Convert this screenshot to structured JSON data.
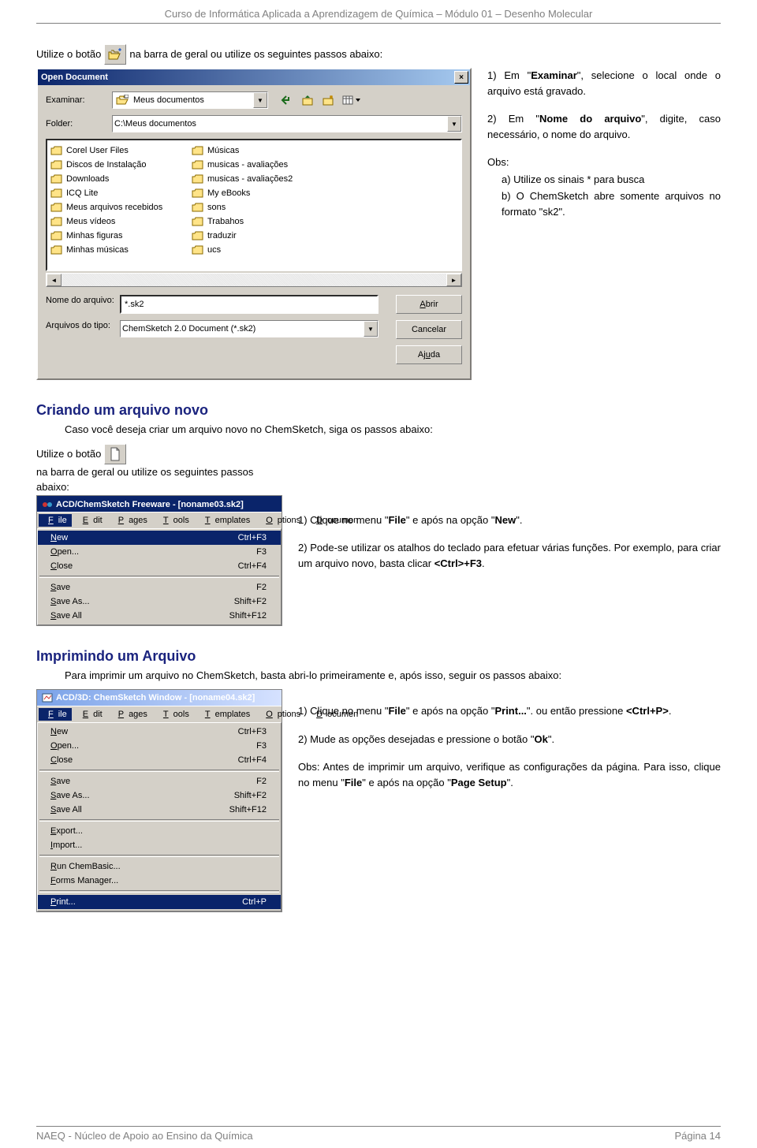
{
  "header": "Curso de Informática Aplicada a Aprendizagem de Química – Módulo 01 – Desenho Molecular",
  "intro_before": "Utilize o botão ",
  "intro_after": " na barra de geral  ou utilize os seguintes passos abaixo:",
  "dlg": {
    "title": "Open Document",
    "lbl_examinar": "Examinar:",
    "combo_examinar": "Meus documentos",
    "lbl_folder": "Folder:",
    "combo_folder": "C:\\Meus documentos",
    "files": [
      "Corel User Files",
      "Discos de Instalação",
      "Downloads",
      "ICQ Lite",
      "Meus arquivos recebidos",
      "Meus vídeos",
      "Minhas figuras",
      "Minhas músicas",
      "Músicas",
      "musicas - avaliações",
      "musicas - avaliações2",
      "My eBooks",
      "sons",
      "Trabahos",
      "traduzir",
      "ucs"
    ],
    "lbl_nome": "Nome do arquivo:",
    "val_nome": "*.sk2",
    "lbl_tipo": "Arquivos do tipo:",
    "val_tipo": "ChemSketch 2.0 Document (*.sk2)",
    "btn_abrir": "Abrir",
    "btn_cancelar": "Cancelar",
    "btn_ajuda": "Ajuda"
  },
  "aside1": {
    "p1_a": "1) Em \"",
    "p1_b": "Examinar",
    "p1_c": "\", selecione o local onde o arquivo está gravado.",
    "p2_a": "2) Em \"",
    "p2_b": "Nome do arquivo",
    "p2_c": "\", digite, caso necessário, o nome do arquivo.",
    "obs": "Obs:",
    "a": "a) Utilize os sinais * para busca",
    "b": "b) O ChemSketch abre somente arquivos no formato \"sk2\"."
  },
  "h2a": "Criando um arquivo novo",
  "sec_a_intro": "Caso você deseja criar um arquivo novo no ChemSketch, siga os passos abaixo:",
  "sec_a_btn_before": "Utilize o botão ",
  "sec_a_btn_after": " na barra de geral  ou utilize os seguintes passos abaixo:",
  "menu1": {
    "title": "ACD/ChemSketch Freeware - [noname03.sk2]",
    "bar": [
      "File",
      "Edit",
      "Pages",
      "Tools",
      "Templates",
      "Options",
      "Documen"
    ],
    "items": [
      {
        "l": "New",
        "r": "Ctrl+F3",
        "sel": true
      },
      {
        "l": "Open...",
        "r": "F3"
      },
      {
        "l": "Close",
        "r": "Ctrl+F4"
      },
      {
        "sep": true
      },
      {
        "l": "Save",
        "r": "F2"
      },
      {
        "l": "Save As...",
        "r": "Shift+F2"
      },
      {
        "l": "Save All",
        "r": "Shift+F12"
      }
    ]
  },
  "aside2": {
    "p1_a": "1) Clique no menu \"",
    "p1_b": "File",
    "p1_c": "\" e após na opção \"",
    "p1_d": "New",
    "p1_e": "\".",
    "p2_a": "2) Pode-se utilizar os atalhos do teclado para efetuar várias funções. Por exemplo, para criar um arquivo novo, basta clicar ",
    "p2_b": "<Ctrl>+F3",
    "p2_c": "."
  },
  "h2b": "Imprimindo um Arquivo",
  "sec_b_intro": "Para imprimir um arquivo no ChemSketch, basta abri-lo primeiramente e, após isso, seguir os passos abaixo:",
  "menu2": {
    "title": "ACD/3D: ChemSketch Window - [noname04.sk2]",
    "bar": [
      "File",
      "Edit",
      "Pages",
      "Tools",
      "Templates",
      "Options",
      "Documen"
    ],
    "items": [
      {
        "l": "New",
        "r": "Ctrl+F3"
      },
      {
        "l": "Open...",
        "r": "F3"
      },
      {
        "l": "Close",
        "r": "Ctrl+F4"
      },
      {
        "sep": true
      },
      {
        "l": "Save",
        "r": "F2"
      },
      {
        "l": "Save As...",
        "r": "Shift+F2"
      },
      {
        "l": "Save All",
        "r": "Shift+F12"
      },
      {
        "sep": true
      },
      {
        "l": "Export...",
        "r": ""
      },
      {
        "l": "Import...",
        "r": ""
      },
      {
        "sep": true
      },
      {
        "l": "Run ChemBasic...",
        "r": ""
      },
      {
        "l": "Forms Manager...",
        "r": ""
      },
      {
        "sep": true
      },
      {
        "l": "Print...",
        "r": "Ctrl+P",
        "sel": true
      }
    ]
  },
  "aside3": {
    "p1_a": "1) Clique no menu \"",
    "p1_b": "File",
    "p1_c": "\" e após na opção \"",
    "p1_d": "Print...",
    "p1_e": "\". ou então pressione ",
    "p1_f": "<Ctrl+P>",
    "p1_g": ".",
    "p2_a": "2) Mude as opções desejadas e pressione o botão \"",
    "p2_b": "Ok",
    "p2_c": "\".",
    "p3_a": "Obs: Antes de imprimir um arquivo, verifique as configurações da página. Para isso, clique no menu \"",
    "p3_b": "File",
    "p3_c": "\" e após na opção \"",
    "p3_d": "Page Setup",
    "p3_e": "\"."
  },
  "footer_l": "NAEQ - Núcleo de Apoio ao Ensino da Química",
  "footer_r": "Página  14"
}
